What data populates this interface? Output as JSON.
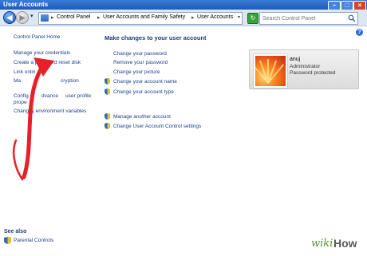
{
  "window": {
    "title": "User Accounts"
  },
  "toolbar": {
    "breadcrumbs": [
      "Control Panel",
      "User Accounts and Family Safety",
      "User Accounts"
    ],
    "search_placeholder": "Search Control Panel"
  },
  "left_pane": {
    "home": "Control Panel Home",
    "links": [
      "Manage your credentials",
      "Create a password reset disk",
      "Link online",
      "Manage file encryption",
      "Configure advanced user profile properties",
      "Change my environment variables"
    ],
    "link_visible_fragments": [
      "Link onlin",
      "Ma",
      "cryption",
      "Config",
      "dvance",
      "user profile",
      "prope",
      "Chang",
      "ny environment variables"
    ]
  },
  "main": {
    "heading": "Make changes to your user account",
    "tasks_group1": [
      "Change your password",
      "Remove your password",
      "Change your picture"
    ],
    "tasks_group2": [
      "Change your account name",
      "Change your account type"
    ],
    "tasks_group3": [
      "Manage another account",
      "Change User Account Control settings"
    ]
  },
  "user": {
    "name": "anuj",
    "role": "Administrator",
    "status": "Password protected"
  },
  "see_also": {
    "label": "See also",
    "items": [
      "Parental Controls"
    ]
  },
  "watermark": {
    "wiki": "wiki",
    "how": "How"
  },
  "colors": {
    "titlebar": "#1f5bb8",
    "link": "#1c3f8c",
    "heading": "#1a3c7a",
    "arrow": "#e8202a"
  },
  "icons": {
    "shield": "uac-shield-icon",
    "back": "back-arrow-icon",
    "forward": "forward-arrow-icon",
    "search": "search-icon",
    "help": "help-icon"
  }
}
